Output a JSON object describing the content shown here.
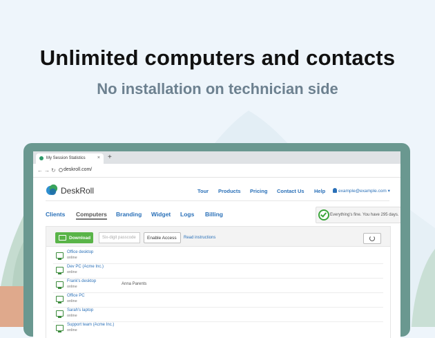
{
  "headline": "Unlimited computers and contacts",
  "subheadline": "No installation on technician side",
  "browser": {
    "tab_title": "My Session Statistics",
    "tab_close": "×",
    "new_tab": "+",
    "url": "deskroll.com/"
  },
  "app": {
    "brand": "DeskRoll",
    "nav": [
      "Tour",
      "Products",
      "Pricing",
      "Contact Us",
      "Help"
    ],
    "user_email": "example@example.com ▾",
    "subnav": [
      "Clients",
      "Computers",
      "Branding",
      "Widget",
      "Logs",
      "Billing"
    ],
    "active_subnav": "Computers",
    "status_text": "Everything's fine. You have 295 days.",
    "toolbar": {
      "download_label": "Download",
      "passcode_placeholder": "Six-digit passcode",
      "enable_access_label": "Enable Access",
      "read_instructions_label": "Read instructions"
    },
    "computers": [
      {
        "name": "Office desktop",
        "status": "online",
        "user": ""
      },
      {
        "name": "Dev PC (Acme Inc.)",
        "status": "online",
        "user": ""
      },
      {
        "name": "Frank's desktop",
        "status": "online",
        "user": "Anna Parents"
      },
      {
        "name": "Office PC",
        "status": "online",
        "user": ""
      },
      {
        "name": "Sarah's laptop",
        "status": "online",
        "user": ""
      },
      {
        "name": "Support team (Acme Inc.)",
        "status": "online",
        "user": ""
      }
    ]
  },
  "colors": {
    "background": "#eef5fb",
    "laptop_frame": "#6a9890",
    "link_blue": "#2a70b8",
    "download_green": "#59b448"
  }
}
